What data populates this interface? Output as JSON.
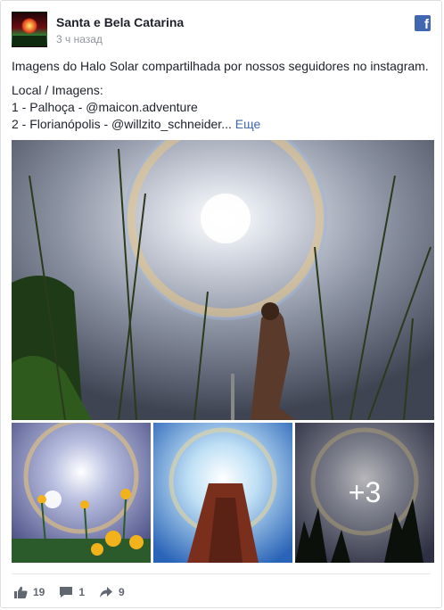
{
  "post": {
    "author": "Santa e Bela Catarina",
    "time": "3 ч назад",
    "brand_icon": "facebook-icon",
    "text_line1": "Imagens do Halo Solar compartilhada por nossos seguidores no instagram.",
    "text_line2": "Local / Imagens:",
    "text_line3": "1 - Palhoça - @maicon.adventure",
    "text_line4": "2 - Florianópolis - @willzito_schneider...",
    "more_label": "Еще"
  },
  "photos": {
    "more_count": "+3"
  },
  "stats": {
    "likes": "19",
    "comments": "1",
    "shares": "9"
  },
  "colors": {
    "accent": "#4267b2",
    "muted": "#90949c"
  }
}
